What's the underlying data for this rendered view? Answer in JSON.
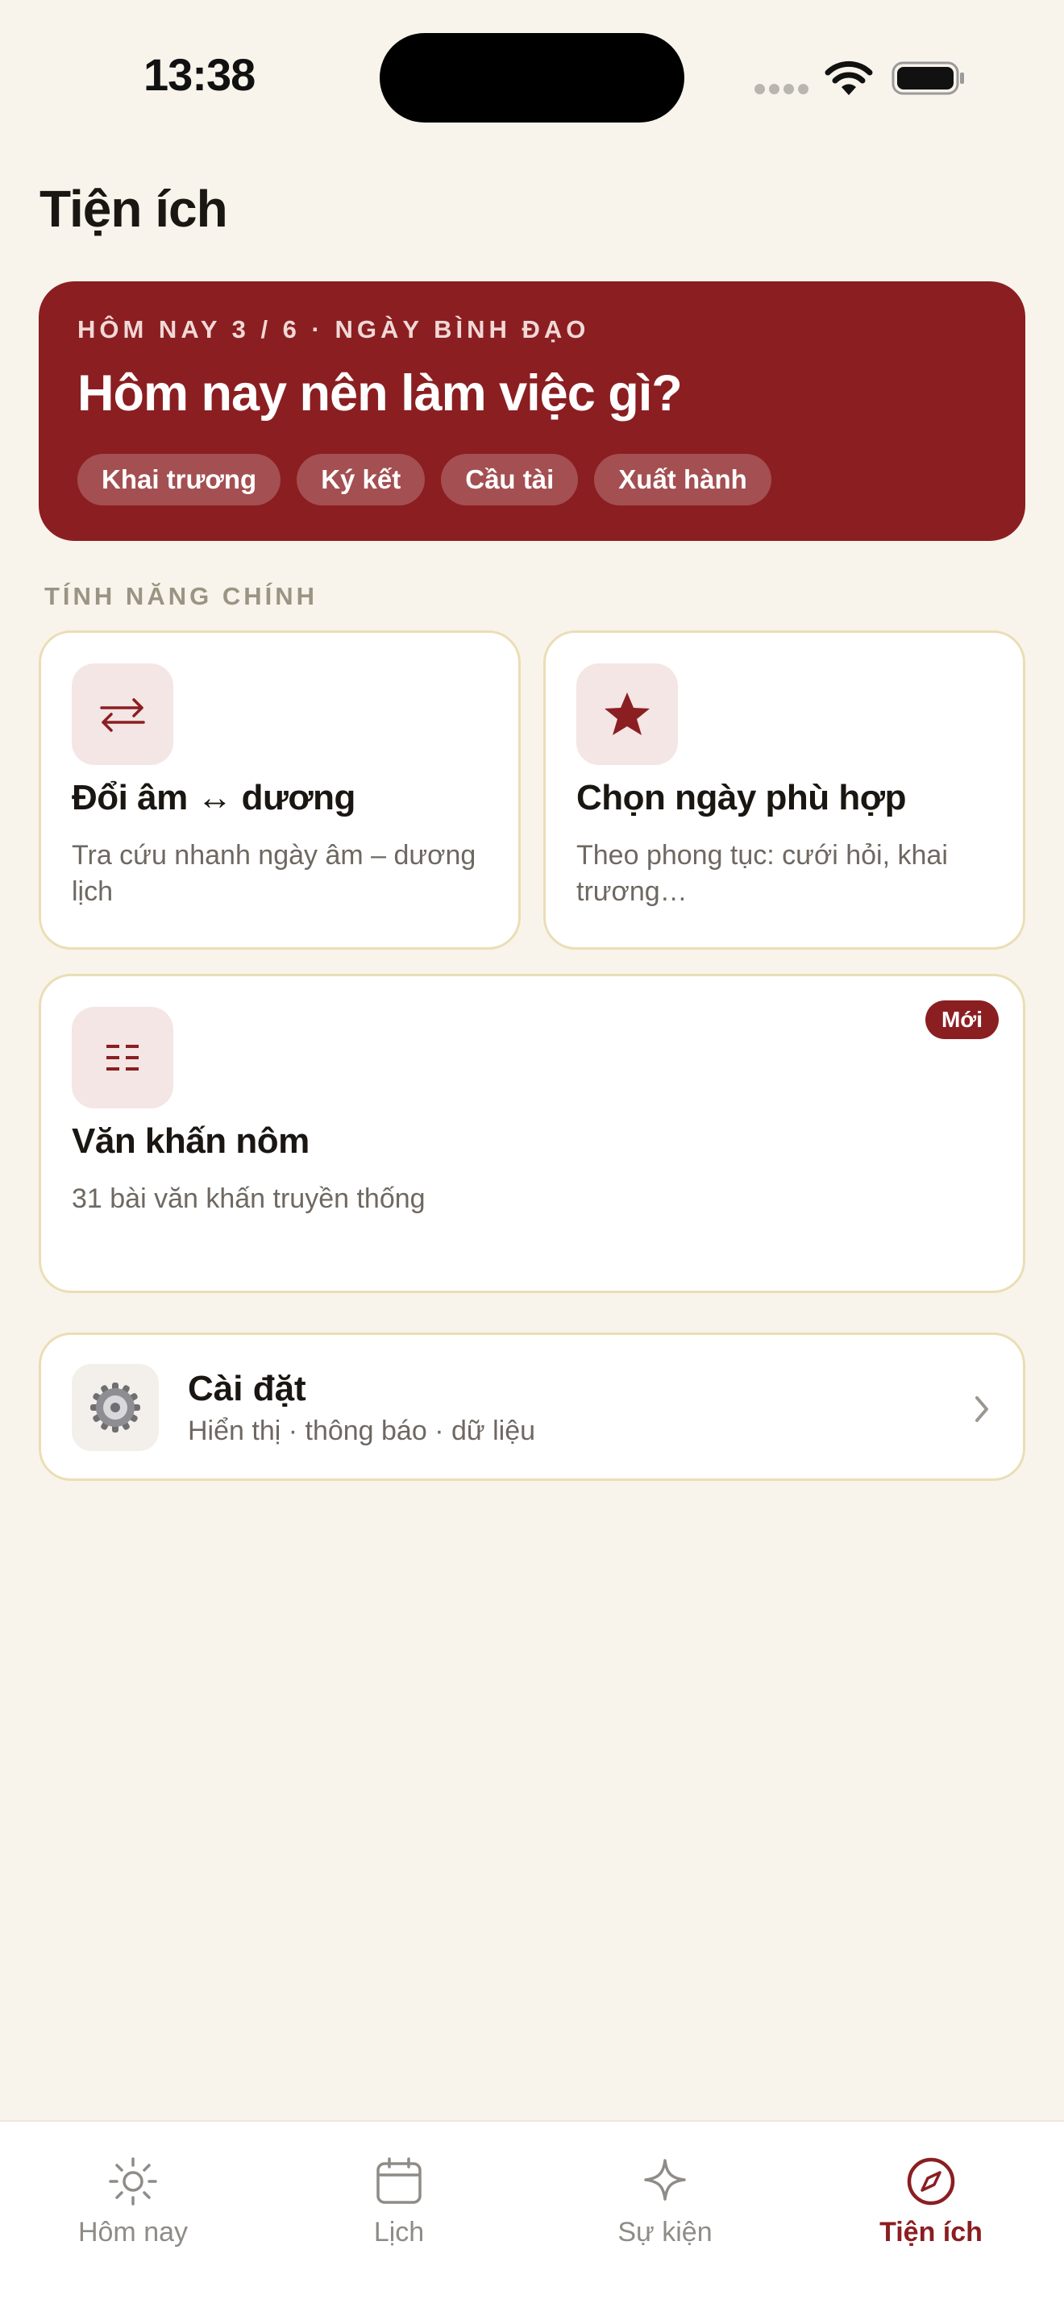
{
  "status_bar": {
    "time": "13:38"
  },
  "header": {
    "title": "Tiện ích"
  },
  "hero": {
    "eyebrow": "HÔM NAY 3 / 6 · NGÀY BÌNH ĐẠO",
    "question": "Hôm nay nên làm việc gì?",
    "tags": [
      "Khai trương",
      "Ký kết",
      "Cầu tài",
      "Xuất hành"
    ]
  },
  "section_label": "TÍNH NĂNG CHÍNH",
  "features": [
    {
      "icon": "swap-arrows-icon",
      "title": "Đổi âm ↔ dương",
      "desc": "Tra cứu nhanh ngày âm – dương lịch"
    },
    {
      "icon": "star-icon",
      "title": "Chọn ngày phù hợp",
      "desc": "Theo phong tục: cưới hỏi, khai trương…"
    },
    {
      "icon": "list-grid-icon",
      "title": "Văn khấn nôm",
      "desc": "31 bài văn khấn truyền thống",
      "badge": "Mới"
    }
  ],
  "settings": {
    "icon": "gear-icon",
    "title": "Cài đặt",
    "subtitle": "Hiển thị · thông báo · dữ liệu"
  },
  "tabbar": {
    "tabs": [
      {
        "label": "Hôm nay",
        "icon": "sun-icon"
      },
      {
        "label": "Lịch",
        "icon": "calendar-icon"
      },
      {
        "label": "Sự kiện",
        "icon": "sparkle-icon"
      },
      {
        "label": "Tiện ích",
        "icon": "compass-icon",
        "active": true
      }
    ]
  },
  "colors": {
    "accent": "#8B1E21",
    "background": "#F8F4EB",
    "card_border": "#EBDDB5"
  }
}
